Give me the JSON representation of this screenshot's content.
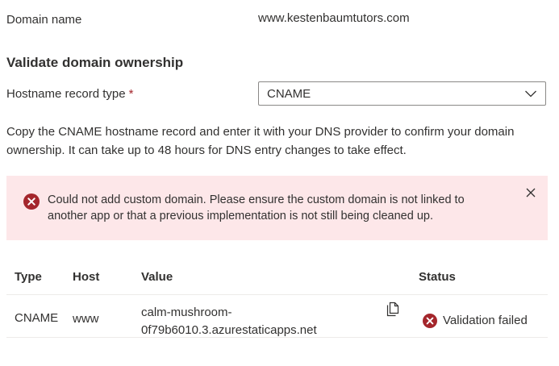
{
  "domain": {
    "label": "Domain name",
    "value": "www.kestenbaumtutors.com"
  },
  "validate": {
    "title": "Validate domain ownership",
    "record_type_label": "Hostname record type",
    "required_mark": "*",
    "record_type_value": "CNAME",
    "description": "Copy the CNAME hostname record and enter it with your DNS provider to confirm your domain ownership. It can take up to 48 hours for DNS entry changes to take effect."
  },
  "error": {
    "message": "Could not add custom domain. Please ensure the custom domain is not linked to another app or that a previous implementation is not still being cleaned up."
  },
  "table": {
    "headers": {
      "type": "Type",
      "host": "Host",
      "value": "Value",
      "status": "Status"
    },
    "rows": [
      {
        "type": "CNAME",
        "host": "www",
        "value_line1": "calm-mushroom-",
        "value_line2": "0f79b6010.3.azurestaticapps.net",
        "status": "Validation failed"
      }
    ]
  },
  "colors": {
    "error_red": "#a4262c",
    "error_background": "#fde7e9",
    "text": "#323130"
  },
  "icons": {
    "error": "error-circle-icon",
    "close": "close-icon",
    "copy": "copy-icon",
    "dropdown": "chevron-down-icon"
  }
}
